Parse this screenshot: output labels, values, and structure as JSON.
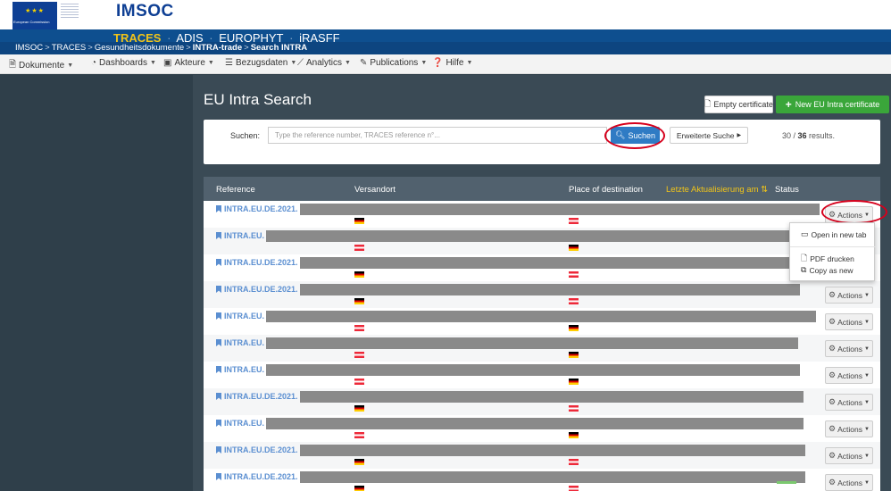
{
  "header": {
    "org": "European Commission",
    "app_title": "IMSOC",
    "systems": [
      "TRACES",
      "ADIS",
      "EUROPHYT",
      "iRASFF"
    ],
    "active_system": "TRACES",
    "breadcrumb": [
      "IMSOC",
      "TRACES",
      "Gesundheitsdokumente",
      "INTRA-trade",
      "Search INTRA"
    ]
  },
  "menu": [
    {
      "label": "Dokumente",
      "icon": "document-icon"
    },
    {
      "label": "Dashboards",
      "icon": "dashboard-icon"
    },
    {
      "label": "Akteure",
      "icon": "id-card-icon"
    },
    {
      "label": "Bezugsdaten",
      "icon": "list-icon"
    },
    {
      "label": "Analytics",
      "icon": "chart-icon"
    },
    {
      "label": "Publications",
      "icon": "pen-icon"
    },
    {
      "label": "Hilfe",
      "icon": "question-icon"
    }
  ],
  "page": {
    "title": "EU Intra Search",
    "empty_certificate": "Empty certificate",
    "new_certificate": "New EU Intra certificate"
  },
  "search": {
    "label": "Suchen:",
    "placeholder": "Type the reference number, TRACES reference n°...",
    "button": "Suchen",
    "advanced": "Erweiterte Suche",
    "results_shown": "30",
    "results_sep": " / ",
    "results_total": "36",
    "results_suffix": " results."
  },
  "table": {
    "columns": [
      "Reference",
      "Versandort",
      "Place of destination",
      "Letzte Aktualisierung am",
      "Status"
    ],
    "actions_label": "Actions",
    "rows": [
      {
        "ref": "INTRA.EU.DE.2021.",
        "origin_flag": "de",
        "dest_flag": "at"
      },
      {
        "ref": "INTRA.EU.",
        "origin_flag": "at",
        "dest_flag": "de"
      },
      {
        "ref": "INTRA.EU.DE.2021.",
        "origin_flag": "de",
        "dest_flag": "at"
      },
      {
        "ref": "INTRA.EU.DE.2021.",
        "origin_flag": "de",
        "dest_flag": "at"
      },
      {
        "ref": "INTRA.EU.",
        "origin_flag": "at",
        "dest_flag": "de"
      },
      {
        "ref": "INTRA.EU.",
        "origin_flag": "at",
        "dest_flag": "de"
      },
      {
        "ref": "INTRA.EU.",
        "origin_flag": "at",
        "dest_flag": "de"
      },
      {
        "ref": "INTRA.EU.DE.2021.",
        "origin_flag": "de",
        "dest_flag": "at"
      },
      {
        "ref": "INTRA.EU.",
        "origin_flag": "at",
        "dest_flag": "de"
      },
      {
        "ref": "INTRA.EU.DE.2021.",
        "origin_flag": "de",
        "dest_flag": "at"
      },
      {
        "ref": "INTRA.EU.DE.2021.",
        "origin_flag": "de",
        "dest_flag": "at"
      }
    ]
  },
  "dropdown": {
    "items": [
      "Open in new tab",
      "PDF drucken",
      "Copy as new"
    ]
  },
  "colors": {
    "header_blue": "#0e4f8f",
    "active_system": "#f0c419",
    "link_blue": "#5b8fd1",
    "primary_button": "#2f7bc4",
    "success_button": "#3aa63a",
    "highlight_ring": "#d6001c"
  }
}
